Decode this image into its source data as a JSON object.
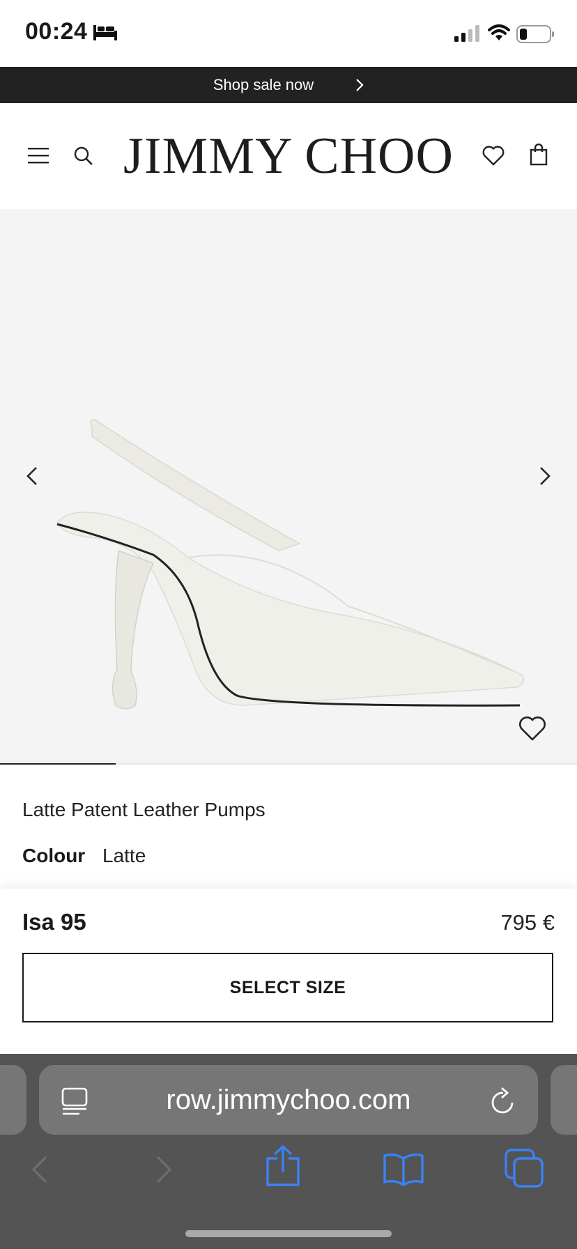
{
  "status_bar": {
    "time": "00:24"
  },
  "banner": {
    "text": "Shop sale now"
  },
  "header": {
    "logo": "JIMMY CHOO"
  },
  "gallery": {
    "image_description_icon": "shoe-image",
    "progress_fraction": 0.2
  },
  "product": {
    "name": "Latte Patent Leather Pumps",
    "colour_label": "Colour",
    "colour_value": "Latte"
  },
  "purchase_bar": {
    "model": "Isa 95",
    "price": "795 €",
    "select_size_label": "SELECT SIZE"
  },
  "browser": {
    "url": "row.jimmychoo.com"
  },
  "colors": {
    "banner_bg": "#222222",
    "gallery_bg": "#f4f4f4",
    "browser_bg": "#545454",
    "browser_accent": "#3b82f6"
  }
}
